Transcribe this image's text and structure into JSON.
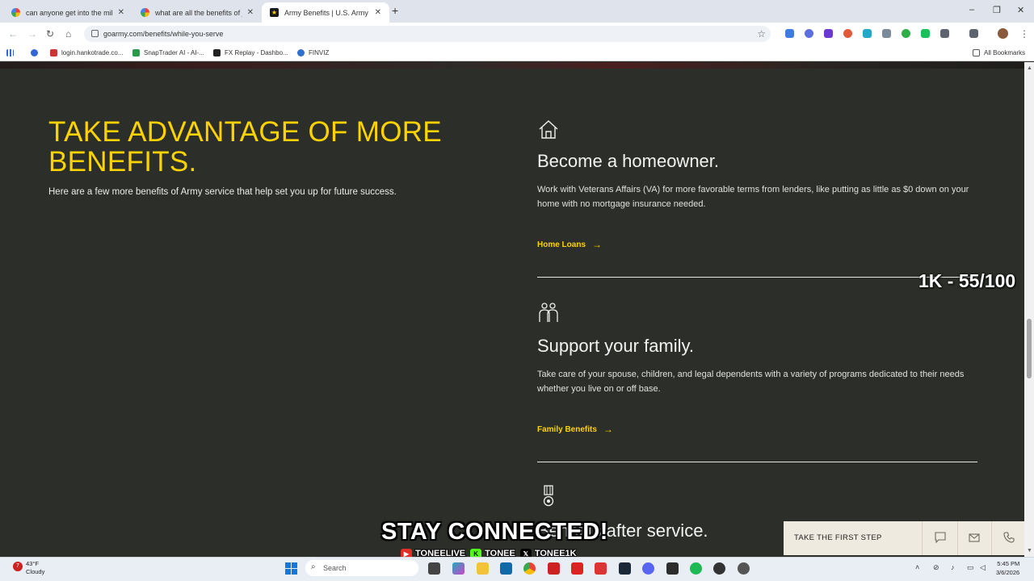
{
  "browser": {
    "tabs": [
      {
        "title": "can anyone get into the militar",
        "favicon": "google-icon",
        "active": false
      },
      {
        "title": "what are all the benefits of joi",
        "favicon": "google-icon",
        "active": false
      },
      {
        "title": "Army Benefits | U.S. Army",
        "favicon": "army-star-icon",
        "active": true
      }
    ],
    "new_tab": "+",
    "window_controls": {
      "minimize": "–",
      "restore": "❐",
      "close": "✕"
    },
    "url": "goarmy.com/benefits/while-you-serve",
    "bookmarks": [
      {
        "label": "login.hankotrade.co..."
      },
      {
        "label": "SnapTrader AI - AI-..."
      },
      {
        "label": "FX Replay - Dashbo..."
      },
      {
        "label": "FINVIZ"
      }
    ],
    "all_bookmarks": "All Bookmarks"
  },
  "section": {
    "title": "TAKE ADVANTAGE OF MORE BENEFITS.",
    "subtitle": "Here are a few more benefits of Army service that help set you up for future success."
  },
  "benefits": [
    {
      "icon": "house-icon",
      "title": "Become a homeowner.",
      "description": "Work with Veterans Affairs (VA) for more favorable terms from lenders, like putting as little as $0 down on your home with no mortgage insurance needed.",
      "link": "Home Loans"
    },
    {
      "icon": "family-icon",
      "title": "Support your family.",
      "description": "Take care of your spouse, children, and legal dependents with a variety of programs dedicated to their needs whether you live on or off base.",
      "link": "Family Benefits"
    },
    {
      "icon": "medal-icon",
      "title": "Benefits after service.",
      "description": "",
      "link": ""
    }
  ],
  "cta": {
    "label": "TAKE THE FIRST STEP",
    "icons": [
      "chat-icon",
      "mail-icon",
      "phone-icon"
    ]
  },
  "overlay": {
    "counter": "1K - 55/100",
    "stay_connected": "STAY CONNECTED!",
    "socials": [
      {
        "platform": "youtube-icon",
        "handle": "TONEELIVE"
      },
      {
        "platform": "kick-icon",
        "handle": "TONEE"
      },
      {
        "platform": "x-icon",
        "handle": "TONEE1K"
      }
    ]
  },
  "taskbar": {
    "weather_badge": "7",
    "weather_temp": "43°F",
    "weather_desc": "Cloudy",
    "search_placeholder": "Search",
    "time": "5:45 PM",
    "date": "3/6/2026"
  },
  "colors": {
    "accent_yellow": "#fcd200",
    "background": "#2c2f29",
    "cta_bar": "#eeeadf"
  }
}
